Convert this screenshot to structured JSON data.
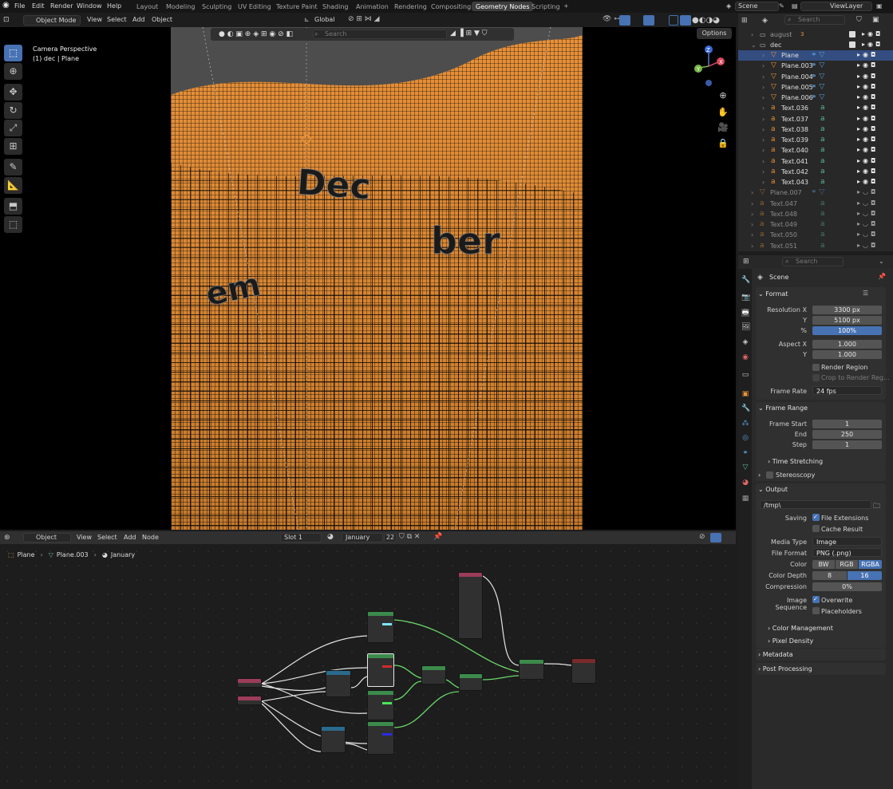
{
  "menu": {
    "file": "File",
    "edit": "Edit",
    "render": "Render",
    "window": "Window",
    "help": "Help"
  },
  "workspaces": [
    "Layout",
    "Modeling",
    "Sculpting",
    "UV Editing",
    "Texture Paint",
    "Shading",
    "Animation",
    "Rendering",
    "Compositing",
    "Geometry Nodes",
    "Scripting"
  ],
  "scene_name": "Scene",
  "view_layer": "ViewLayer",
  "viewport": {
    "mode": "Object Mode",
    "menus": [
      "View",
      "Select",
      "Add",
      "Object"
    ],
    "orientation": "Global",
    "options_label": "Options",
    "search_placeholder": "Search",
    "camera_title": "Camera Perspective",
    "camera_subtitle": "(1) dec | Plane",
    "scene_words": [
      "Dec",
      "ber",
      "em"
    ],
    "axis": {
      "x": "X",
      "y": "Y",
      "z": "Z"
    }
  },
  "node_editor": {
    "mode": "Object",
    "menus": [
      "View",
      "Select",
      "Add",
      "Node"
    ],
    "slot": "Slot 1",
    "material": "January",
    "users": "22",
    "breadcrumb": {
      "object": "Plane",
      "mesh": "Plane.003",
      "material": "January"
    }
  },
  "outliner": {
    "search_placeholder": "Search",
    "collections": [
      {
        "name": "august",
        "badge": "3"
      },
      {
        "name": "dec"
      }
    ],
    "items": [
      {
        "name": "Plane",
        "type": "mesh",
        "selected": true,
        "disabled": false
      },
      {
        "name": "Plane.003",
        "type": "mesh",
        "selected": false,
        "disabled": false
      },
      {
        "name": "Plane.004",
        "type": "mesh",
        "selected": false,
        "disabled": false
      },
      {
        "name": "Plane.005",
        "type": "mesh",
        "selected": false,
        "disabled": false
      },
      {
        "name": "Plane.006",
        "type": "mesh",
        "selected": false,
        "disabled": false
      },
      {
        "name": "Text.036",
        "type": "text",
        "selected": false,
        "disabled": false
      },
      {
        "name": "Text.037",
        "type": "text",
        "selected": false,
        "disabled": false
      },
      {
        "name": "Text.038",
        "type": "text",
        "selected": false,
        "disabled": false
      },
      {
        "name": "Text.039",
        "type": "text",
        "selected": false,
        "disabled": false
      },
      {
        "name": "Text.040",
        "type": "text",
        "selected": false,
        "disabled": false
      },
      {
        "name": "Text.041",
        "type": "text",
        "selected": false,
        "disabled": false
      },
      {
        "name": "Text.042",
        "type": "text",
        "selected": false,
        "disabled": false
      },
      {
        "name": "Text.043",
        "type": "text",
        "selected": false,
        "disabled": false
      },
      {
        "name": "Plane.007",
        "type": "mesh",
        "selected": false,
        "disabled": true
      },
      {
        "name": "Text.047",
        "type": "text",
        "selected": false,
        "disabled": true
      },
      {
        "name": "Text.048",
        "type": "text",
        "selected": false,
        "disabled": true
      },
      {
        "name": "Text.049",
        "type": "text",
        "selected": false,
        "disabled": true
      },
      {
        "name": "Text.050",
        "type": "text",
        "selected": false,
        "disabled": true
      },
      {
        "name": "Text.051",
        "type": "text",
        "selected": false,
        "disabled": true
      }
    ]
  },
  "properties": {
    "search_placeholder": "Search",
    "context": "Scene",
    "format": {
      "title": "Format",
      "res_x_label": "Resolution X",
      "res_x": "3300 px",
      "res_y_label": "Y",
      "res_y": "5100 px",
      "pct_label": "%",
      "pct": "100%",
      "aspect_x_label": "Aspect X",
      "aspect_x": "1.000",
      "aspect_y_label": "Y",
      "aspect_y": "1.000",
      "render_region": "Render Region",
      "crop": "Crop to Render Reg...",
      "frame_rate_label": "Frame Rate",
      "frame_rate": "24 fps"
    },
    "frame_range": {
      "title": "Frame Range",
      "start_label": "Frame Start",
      "start": "1",
      "end_label": "End",
      "end": "250",
      "step_label": "Step",
      "step": "1",
      "time_stretching": "Time Stretching"
    },
    "stereoscopy": "Stereoscopy",
    "output": {
      "title": "Output",
      "path": "/tmp\\",
      "saving_label": "Saving",
      "file_ext": "File Extensions",
      "cache": "Cache Result",
      "media_type_label": "Media Type",
      "media_type": "Image",
      "file_format_label": "File Format",
      "file_format": "PNG (.png)",
      "color_label": "Color",
      "color_opts": [
        "BW",
        "RGB",
        "RGBA"
      ],
      "depth_label": "Color Depth",
      "depth_opts": [
        "8",
        "16"
      ],
      "compression_label": "Compression",
      "compression": "0%",
      "image_seq_label": "Image Sequence",
      "overwrite": "Overwrite",
      "placeholders": "Placeholders",
      "color_mgmt": "Color Management",
      "pixel_density": "Pixel Density"
    },
    "metadata": "Metadata",
    "post_processing": "Post Processing"
  },
  "colors": {
    "accent": "#4772b3",
    "mesh_orange": "#e8913a",
    "text_green": "#5fb98f",
    "link_green": "#6ad86a"
  }
}
